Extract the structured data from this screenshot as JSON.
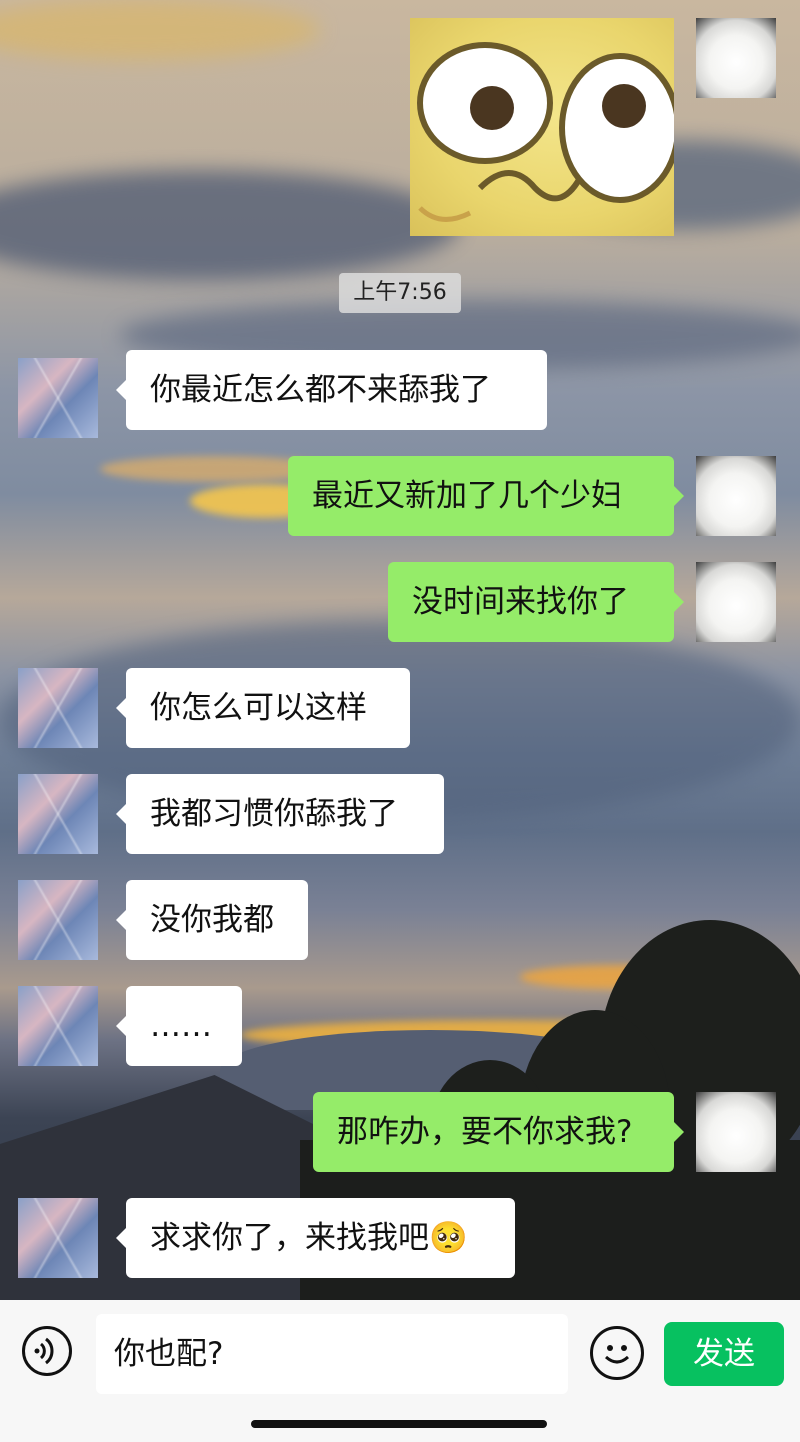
{
  "timestamp": "上午7:56",
  "messages": [
    {
      "side": "in",
      "text": "你最近怎么都不来舔我了"
    },
    {
      "side": "out",
      "text": "最近又新加了几个少妇"
    },
    {
      "side": "out",
      "text": "没时间来找你了"
    },
    {
      "side": "in",
      "text": "你怎么可以这样"
    },
    {
      "side": "in",
      "text": "我都习惯你舔我了"
    },
    {
      "side": "in",
      "text": "没你我都"
    },
    {
      "side": "in",
      "text": "……"
    },
    {
      "side": "out",
      "text": "那咋办，要不你求我?"
    },
    {
      "side": "in",
      "text": "求求你了，来找我吧",
      "emoji": "🥺"
    }
  ],
  "input": {
    "value": "你也配?"
  },
  "send_label": "发送",
  "icons": {
    "voice": "voice-icon",
    "emoji": "emoji-icon"
  },
  "colors": {
    "outgoing_bubble": "#95ec69",
    "incoming_bubble": "#ffffff",
    "send_button": "#07c160"
  }
}
